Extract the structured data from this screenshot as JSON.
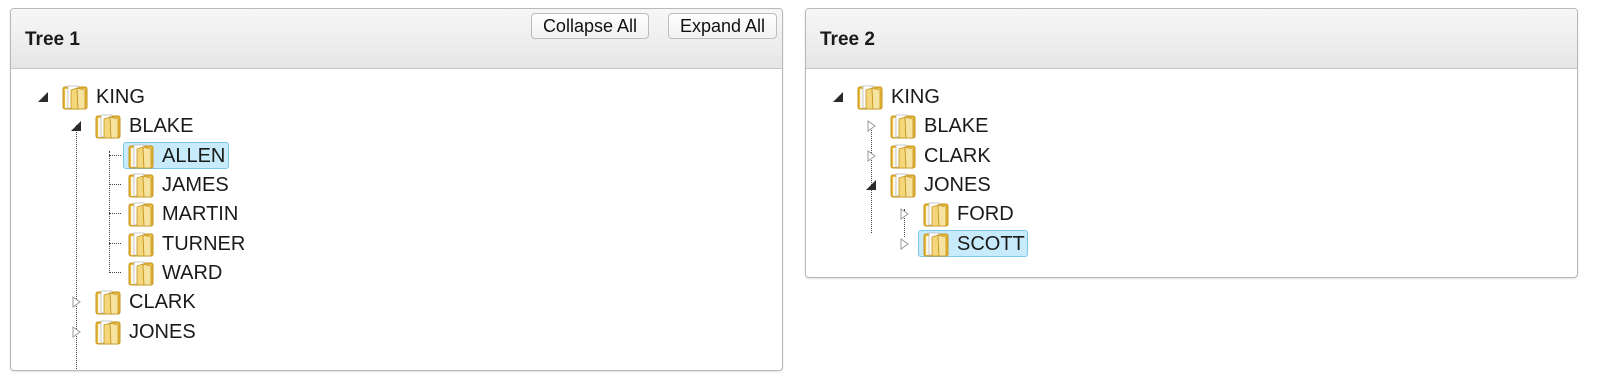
{
  "tree1": {
    "title": "Tree 1",
    "collapse_all_label": "Collapse All",
    "expand_all_label": "Expand All",
    "nodes": [
      {
        "label": "KING",
        "state": "expanded"
      },
      {
        "label": "BLAKE",
        "state": "expanded"
      },
      {
        "label": "ALLEN",
        "state": "leaf",
        "selected": true
      },
      {
        "label": "JAMES",
        "state": "leaf"
      },
      {
        "label": "MARTIN",
        "state": "leaf"
      },
      {
        "label": "TURNER",
        "state": "leaf"
      },
      {
        "label": "WARD",
        "state": "leaf"
      },
      {
        "label": "CLARK",
        "state": "collapsed"
      },
      {
        "label": "JONES",
        "state": "collapsed"
      }
    ]
  },
  "tree2": {
    "title": "Tree 2",
    "nodes": [
      {
        "label": "KING",
        "state": "expanded"
      },
      {
        "label": "BLAKE",
        "state": "collapsed"
      },
      {
        "label": "CLARK",
        "state": "collapsed"
      },
      {
        "label": "JONES",
        "state": "expanded"
      },
      {
        "label": "FORD",
        "state": "collapsed"
      },
      {
        "label": "SCOTT",
        "state": "collapsed",
        "selected": true
      }
    ]
  },
  "icons": {
    "expanded": "triangle-expanded-icon",
    "collapsed": "triangle-collapsed-icon",
    "node": "folder-icon"
  },
  "colors": {
    "selection_fill": "#c7ebfb",
    "selection_border": "#7cc7ea",
    "folder": "#f2c94c"
  }
}
